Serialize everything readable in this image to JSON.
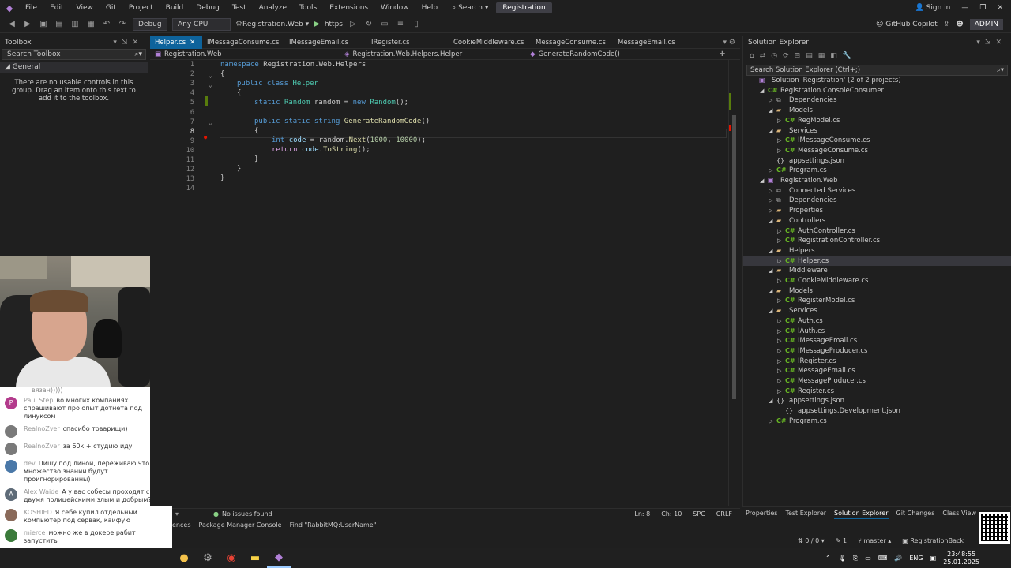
{
  "menu": {
    "items": [
      "File",
      "Edit",
      "View",
      "Git",
      "Project",
      "Build",
      "Debug",
      "Test",
      "Analyze",
      "Tools",
      "Extensions",
      "Window",
      "Help"
    ],
    "search_label": "Search",
    "solution_name": "Registration",
    "sign_in": "Sign in"
  },
  "toolbar": {
    "config": "Debug",
    "platform": "Any CPU",
    "startup": "Registration.Web",
    "profile": "https",
    "copilot": "GitHub Copilot",
    "admin": "ADMIN"
  },
  "toolbox": {
    "title": "Toolbox",
    "search_placeholder": "Search Toolbox",
    "group": "General",
    "empty_text": "There are no usable controls in this group. Drag an item onto this text to add it to the toolbox."
  },
  "chat": {
    "top_fragment": "вязан)))))",
    "messages": [
      {
        "user": "Paul Step",
        "text": "во многих компаниях спрашивают про опыт дотнета под линуксом",
        "avatar": "P",
        "color": "#b33b8c"
      },
      {
        "user": "RealnoZver",
        "text": "спасибо товарищи)",
        "avatar": "",
        "color": "#7a7a7a"
      },
      {
        "user": "RealnoZver",
        "text": "за 60к + студию иду",
        "avatar": "",
        "color": "#7a7a7a"
      },
      {
        "user": "dev",
        "text": "Пишу под линой, переживаю что множество знаний будут проигнорированны)",
        "avatar": "",
        "color": "#4a78a8"
      },
      {
        "user": "Alex Waide",
        "text": "А у вас собесы проходят с двумя полицейскими злым и добрым?",
        "avatar": "A",
        "color": "#5e6b78"
      },
      {
        "user": "KOSHIED",
        "text": "Я себе купил отдельный компьютер под сервак, кайфую",
        "avatar": "",
        "color": "#8a6a5a"
      },
      {
        "user": "mierce",
        "text": "можно же в докере рабит запустить",
        "avatar": "",
        "color": "#3a7a3a"
      }
    ]
  },
  "editor": {
    "tabs": [
      {
        "label": "Helper.cs",
        "active": true
      },
      {
        "label": "IMessageConsume.cs",
        "active": false
      },
      {
        "label": "IMessageEmail.cs",
        "active": false
      },
      {
        "label": "IRegister.cs",
        "active": false
      },
      {
        "label": "CookieMiddleware.cs",
        "active": false
      },
      {
        "label": "MessageConsume.cs",
        "active": false
      },
      {
        "label": "MessageEmail.cs",
        "active": false
      }
    ],
    "nav_project": "Registration.Web",
    "nav_class": "Registration.Web.Helpers.Helper",
    "nav_member": "GenerateRandomCode()",
    "line_numbers": [
      "1",
      "2",
      "3",
      "4",
      "5",
      "6",
      "7",
      "8",
      "9",
      "10",
      "11",
      "12",
      "13",
      "14"
    ],
    "current_line": 8
  },
  "status_editor": {
    "issues": "No issues found",
    "ln": "Ln: 8",
    "ch": "Ch: 10",
    "spc": "SPC",
    "crlf": "CRLF"
  },
  "bottom_tabs": [
    "ences",
    "Package Manager Console",
    "Find \"RabbitMQ:UserName\""
  ],
  "solution_explorer": {
    "title": "Solution Explorer",
    "search_placeholder": "Search Solution Explorer (Ctrl+;)",
    "tree": [
      {
        "label": "Solution 'Registration' (2 of 2 projects)",
        "level": 0,
        "exp": "",
        "icon": "sln"
      },
      {
        "label": "Registration.ConsoleConsumer",
        "level": 1,
        "exp": "open",
        "icon": "proj"
      },
      {
        "label": "Dependencies",
        "level": 2,
        "exp": "closed",
        "icon": "dep"
      },
      {
        "label": "Models",
        "level": 2,
        "exp": "open",
        "icon": "folder"
      },
      {
        "label": "RegModel.cs",
        "level": 3,
        "exp": "closed",
        "icon": "cs"
      },
      {
        "label": "Services",
        "level": 2,
        "exp": "open",
        "icon": "folder"
      },
      {
        "label": "IMessageConsume.cs",
        "level": 3,
        "exp": "closed",
        "icon": "cs"
      },
      {
        "label": "MessageConsume.cs",
        "level": 3,
        "exp": "closed",
        "icon": "cs"
      },
      {
        "label": "appsettings.json",
        "level": 2,
        "exp": "",
        "icon": "json"
      },
      {
        "label": "Program.cs",
        "level": 2,
        "exp": "closed",
        "icon": "cs"
      },
      {
        "label": "Registration.Web",
        "level": 1,
        "exp": "open",
        "icon": "web"
      },
      {
        "label": "Connected Services",
        "level": 2,
        "exp": "closed",
        "icon": "dep"
      },
      {
        "label": "Dependencies",
        "level": 2,
        "exp": "closed",
        "icon": "dep"
      },
      {
        "label": "Properties",
        "level": 2,
        "exp": "closed",
        "icon": "folder"
      },
      {
        "label": "Controllers",
        "level": 2,
        "exp": "open",
        "icon": "folder"
      },
      {
        "label": "AuthController.cs",
        "level": 3,
        "exp": "closed",
        "icon": "cs"
      },
      {
        "label": "RegistrationController.cs",
        "level": 3,
        "exp": "closed",
        "icon": "cs"
      },
      {
        "label": "Helpers",
        "level": 2,
        "exp": "open",
        "icon": "folder"
      },
      {
        "label": "Helper.cs",
        "level": 3,
        "exp": "closed",
        "icon": "cs",
        "selected": true
      },
      {
        "label": "Middleware",
        "level": 2,
        "exp": "open",
        "icon": "folder"
      },
      {
        "label": "CookieMiddleware.cs",
        "level": 3,
        "exp": "closed",
        "icon": "cs"
      },
      {
        "label": "Models",
        "level": 2,
        "exp": "open",
        "icon": "folder"
      },
      {
        "label": "RegisterModel.cs",
        "level": 3,
        "exp": "closed",
        "icon": "cs"
      },
      {
        "label": "Services",
        "level": 2,
        "exp": "open",
        "icon": "folder"
      },
      {
        "label": "Auth.cs",
        "level": 3,
        "exp": "closed",
        "icon": "cs"
      },
      {
        "label": "IAuth.cs",
        "level": 3,
        "exp": "closed",
        "icon": "cs"
      },
      {
        "label": "IMessageEmail.cs",
        "level": 3,
        "exp": "closed",
        "icon": "cs"
      },
      {
        "label": "IMessageProducer.cs",
        "level": 3,
        "exp": "closed",
        "icon": "cs"
      },
      {
        "label": "IRegister.cs",
        "level": 3,
        "exp": "closed",
        "icon": "cs"
      },
      {
        "label": "MessageEmail.cs",
        "level": 3,
        "exp": "closed",
        "icon": "cs"
      },
      {
        "label": "MessageProducer.cs",
        "level": 3,
        "exp": "closed",
        "icon": "cs"
      },
      {
        "label": "Register.cs",
        "level": 3,
        "exp": "closed",
        "icon": "cs"
      },
      {
        "label": "appsettings.json",
        "level": 2,
        "exp": "open",
        "icon": "json"
      },
      {
        "label": "appsettings.Development.json",
        "level": 3,
        "exp": "",
        "icon": "json"
      },
      {
        "label": "Program.cs",
        "level": 2,
        "exp": "closed",
        "icon": "cs"
      }
    ],
    "bottom_tabs": [
      "Properties",
      "Test Explorer",
      "Solution Explorer",
      "Git Changes",
      "Class View"
    ]
  },
  "vs_status": {
    "changes": "0 / 0",
    "commits": "1",
    "branch": "master",
    "repo": "RegistrationBack"
  },
  "taskbar": {
    "lang": "ENG",
    "time": "23:48:55",
    "date": "25.01.2025"
  }
}
